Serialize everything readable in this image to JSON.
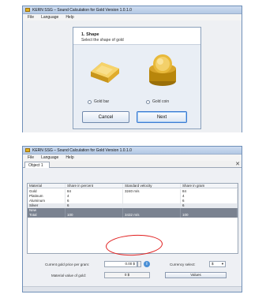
{
  "window1": {
    "title": "KERN SSG – Sound Calculation for Gold   Version 1.0.1.0",
    "menu": [
      "File",
      "Language",
      "Help"
    ],
    "dialog": {
      "step_title": "1. Shape",
      "step_subtitle": "Select the shape of gold",
      "option_bar_label": "Gold bar",
      "option_coin_label": "Gold coin",
      "cancel_label": "Cancel",
      "next_label": "Next"
    }
  },
  "window2": {
    "title": "KERN SSG – Sound Calculation for Gold   Version 1.0.1.0",
    "menu": [
      "File",
      "Language",
      "Help"
    ],
    "tab_label": "Object 1",
    "tab_close": "✕",
    "table": {
      "columns": [
        "Material",
        "Share in percent",
        "Standard velocity",
        "Share in gram"
      ],
      "rows": [
        [
          "Gold",
          "84",
          "3240 m/s",
          "84"
        ],
        [
          "Platinum",
          "4",
          "",
          "4"
        ],
        [
          "Aluminum",
          "6",
          "",
          "6"
        ],
        [
          "Silver",
          "6",
          "",
          "6"
        ],
        [
          "New",
          "",
          "",
          ""
        ],
        [
          "Total",
          "100",
          "3432 m/s",
          "100"
        ]
      ]
    },
    "form": {
      "price_label": "Current gold price per gram:",
      "price_value": "0.00 $",
      "info_icon_glyph": "i",
      "currency_label": "Currency select:",
      "currency_value": "$",
      "currency_arrow": "▼",
      "material_value_label": "Material value of gold:",
      "material_value": "0 $",
      "values_button": "Values"
    }
  },
  "colors": {
    "title_bar": "#b8cce8",
    "selection_row": "#7a8290",
    "highlight_circle": "#e12020",
    "gold": "#d4a017"
  }
}
